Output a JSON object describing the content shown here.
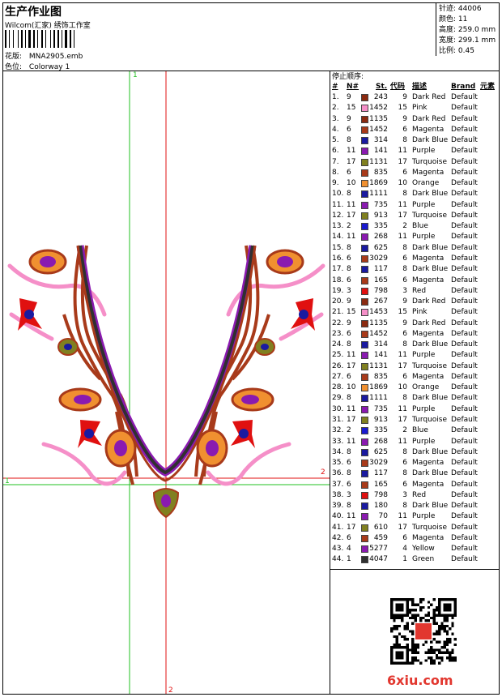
{
  "header": {
    "title": "生产作业图",
    "subtitle": "Wilcom(汇家) 绣饰工作室",
    "design_file_label": "花版:",
    "design_file": "MNA2905.emb",
    "colorway_label": "色位:",
    "colorway": "Colorway 1"
  },
  "stats": [
    {
      "label": "针迹:",
      "value": "44006"
    },
    {
      "label": "颜色:",
      "value": "11"
    },
    {
      "label": "高度:",
      "value": "259.0 mm"
    },
    {
      "label": "宽度:",
      "value": "299.1 mm"
    },
    {
      "label": "比例:",
      "value": "0.45"
    }
  ],
  "axes": {
    "v1": "1",
    "v2": "2",
    "h1": "1",
    "h2": "2"
  },
  "table": {
    "title": "停止顺序:",
    "headers": {
      "idx": "#",
      "no": "N#",
      "st": "St.",
      "code": "代码",
      "desc": "描述",
      "brand": "Brand",
      "elem": "元素"
    },
    "rows": [
      {
        "idx": "1.",
        "no": "9",
        "st": "243",
        "code": "9",
        "desc": "Dark Red",
        "brand": "Default",
        "color": "#8b2a10"
      },
      {
        "idx": "2.",
        "no": "15",
        "st": "1452",
        "code": "15",
        "desc": "Pink",
        "brand": "Default",
        "color": "#f58fc8"
      },
      {
        "idx": "3.",
        "no": "9",
        "st": "1135",
        "code": "9",
        "desc": "Dark Red",
        "brand": "Default",
        "color": "#8b2a10"
      },
      {
        "idx": "4.",
        "no": "6",
        "st": "1452",
        "code": "6",
        "desc": "Magenta",
        "brand": "Default",
        "color": "#a83a1a"
      },
      {
        "idx": "5.",
        "no": "8",
        "st": "314",
        "code": "8",
        "desc": "Dark Blue",
        "brand": "Default",
        "color": "#1a1aa0"
      },
      {
        "idx": "6.",
        "no": "11",
        "st": "141",
        "code": "11",
        "desc": "Purple",
        "brand": "Default",
        "color": "#8a1ab0"
      },
      {
        "idx": "7.",
        "no": "17",
        "st": "1131",
        "code": "17",
        "desc": "Turquoise",
        "brand": "Default",
        "color": "#808020"
      },
      {
        "idx": "8.",
        "no": "6",
        "st": "835",
        "code": "6",
        "desc": "Magenta",
        "brand": "Default",
        "color": "#a83a1a"
      },
      {
        "idx": "9.",
        "no": "10",
        "st": "1869",
        "code": "10",
        "desc": "Orange",
        "brand": "Default",
        "color": "#f09030"
      },
      {
        "idx": "10.",
        "no": "8",
        "st": "1111",
        "code": "8",
        "desc": "Dark Blue",
        "brand": "Default",
        "color": "#1a1aa0"
      },
      {
        "idx": "11.",
        "no": "11",
        "st": "735",
        "code": "11",
        "desc": "Purple",
        "brand": "Default",
        "color": "#8a1ab0"
      },
      {
        "idx": "12.",
        "no": "17",
        "st": "913",
        "code": "17",
        "desc": "Turquoise",
        "brand": "Default",
        "color": "#808020"
      },
      {
        "idx": "13.",
        "no": "2",
        "st": "335",
        "code": "2",
        "desc": "Blue",
        "brand": "Default",
        "color": "#1a1ad0"
      },
      {
        "idx": "14.",
        "no": "11",
        "st": "268",
        "code": "11",
        "desc": "Purple",
        "brand": "Default",
        "color": "#8a1ab0"
      },
      {
        "idx": "15.",
        "no": "8",
        "st": "625",
        "code": "8",
        "desc": "Dark Blue",
        "brand": "Default",
        "color": "#1a1aa0"
      },
      {
        "idx": "16.",
        "no": "6",
        "st": "3029",
        "code": "6",
        "desc": "Magenta",
        "brand": "Default",
        "color": "#a83a1a"
      },
      {
        "idx": "17.",
        "no": "8",
        "st": "117",
        "code": "8",
        "desc": "Dark Blue",
        "brand": "Default",
        "color": "#1a1aa0"
      },
      {
        "idx": "18.",
        "no": "6",
        "st": "165",
        "code": "6",
        "desc": "Magenta",
        "brand": "Default",
        "color": "#a83a1a"
      },
      {
        "idx": "19.",
        "no": "3",
        "st": "798",
        "code": "3",
        "desc": "Red",
        "brand": "Default",
        "color": "#e01010"
      },
      {
        "idx": "20.",
        "no": "9",
        "st": "267",
        "code": "9",
        "desc": "Dark Red",
        "brand": "Default",
        "color": "#8b2a10"
      },
      {
        "idx": "21.",
        "no": "15",
        "st": "1453",
        "code": "15",
        "desc": "Pink",
        "brand": "Default",
        "color": "#f58fc8"
      },
      {
        "idx": "22.",
        "no": "9",
        "st": "1135",
        "code": "9",
        "desc": "Dark Red",
        "brand": "Default",
        "color": "#8b2a10"
      },
      {
        "idx": "23.",
        "no": "6",
        "st": "1452",
        "code": "6",
        "desc": "Magenta",
        "brand": "Default",
        "color": "#a83a1a"
      },
      {
        "idx": "24.",
        "no": "8",
        "st": "314",
        "code": "8",
        "desc": "Dark Blue",
        "brand": "Default",
        "color": "#1a1aa0"
      },
      {
        "idx": "25.",
        "no": "11",
        "st": "141",
        "code": "11",
        "desc": "Purple",
        "brand": "Default",
        "color": "#8a1ab0"
      },
      {
        "idx": "26.",
        "no": "17",
        "st": "1131",
        "code": "17",
        "desc": "Turquoise",
        "brand": "Default",
        "color": "#808020"
      },
      {
        "idx": "27.",
        "no": "6",
        "st": "835",
        "code": "6",
        "desc": "Magenta",
        "brand": "Default",
        "color": "#a83a1a"
      },
      {
        "idx": "28.",
        "no": "10",
        "st": "1869",
        "code": "10",
        "desc": "Orange",
        "brand": "Default",
        "color": "#f09030"
      },
      {
        "idx": "29.",
        "no": "8",
        "st": "1111",
        "code": "8",
        "desc": "Dark Blue",
        "brand": "Default",
        "color": "#1a1aa0"
      },
      {
        "idx": "30.",
        "no": "11",
        "st": "735",
        "code": "11",
        "desc": "Purple",
        "brand": "Default",
        "color": "#8a1ab0"
      },
      {
        "idx": "31.",
        "no": "17",
        "st": "913",
        "code": "17",
        "desc": "Turquoise",
        "brand": "Default",
        "color": "#808020"
      },
      {
        "idx": "32.",
        "no": "2",
        "st": "335",
        "code": "2",
        "desc": "Blue",
        "brand": "Default",
        "color": "#1a1ad0"
      },
      {
        "idx": "33.",
        "no": "11",
        "st": "268",
        "code": "11",
        "desc": "Purple",
        "brand": "Default",
        "color": "#8a1ab0"
      },
      {
        "idx": "34.",
        "no": "8",
        "st": "625",
        "code": "8",
        "desc": "Dark Blue",
        "brand": "Default",
        "color": "#1a1aa0"
      },
      {
        "idx": "35.",
        "no": "6",
        "st": "3029",
        "code": "6",
        "desc": "Magenta",
        "brand": "Default",
        "color": "#a83a1a"
      },
      {
        "idx": "36.",
        "no": "8",
        "st": "117",
        "code": "8",
        "desc": "Dark Blue",
        "brand": "Default",
        "color": "#1a1aa0"
      },
      {
        "idx": "37.",
        "no": "6",
        "st": "165",
        "code": "6",
        "desc": "Magenta",
        "brand": "Default",
        "color": "#a83a1a"
      },
      {
        "idx": "38.",
        "no": "3",
        "st": "798",
        "code": "3",
        "desc": "Red",
        "brand": "Default",
        "color": "#e01010"
      },
      {
        "idx": "39.",
        "no": "8",
        "st": "180",
        "code": "8",
        "desc": "Dark Blue",
        "brand": "Default",
        "color": "#1a1aa0"
      },
      {
        "idx": "40.",
        "no": "11",
        "st": "70",
        "code": "11",
        "desc": "Purple",
        "brand": "Default",
        "color": "#8a1ab0"
      },
      {
        "idx": "41.",
        "no": "17",
        "st": "610",
        "code": "17",
        "desc": "Turquoise",
        "brand": "Default",
        "color": "#808020"
      },
      {
        "idx": "42.",
        "no": "6",
        "st": "459",
        "code": "6",
        "desc": "Magenta",
        "brand": "Default",
        "color": "#a83a1a"
      },
      {
        "idx": "43.",
        "no": "4",
        "st": "5277",
        "code": "4",
        "desc": "Yellow",
        "brand": "Default",
        "color": "#8a1ab0"
      },
      {
        "idx": "44.",
        "no": "1",
        "st": "4047",
        "code": "1",
        "desc": "Green",
        "brand": "Default",
        "color": "#303030"
      }
    ]
  },
  "watermark": "6xiu.com"
}
